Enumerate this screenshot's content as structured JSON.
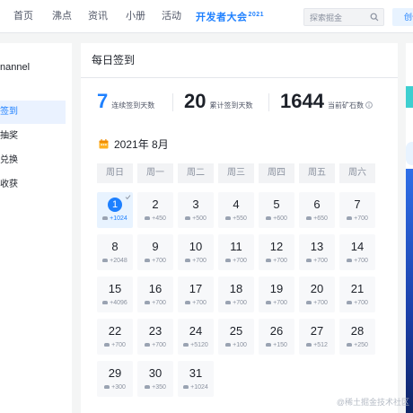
{
  "nav": {
    "items": [
      "首页",
      "沸点",
      "资讯",
      "小册",
      "活动"
    ],
    "brand": "开发者大会",
    "brand_year": "2021",
    "search_placeholder": "探索掘金",
    "create_label": "创作者中心"
  },
  "sidebar": {
    "title": "nannel",
    "items": [
      {
        "label": "签到",
        "active": true
      },
      {
        "label": "抽奖",
        "active": false
      },
      {
        "label": "兑换",
        "active": false
      },
      {
        "label": "收获",
        "active": false
      }
    ]
  },
  "main": {
    "title": "每日签到",
    "stats": [
      {
        "value": "7",
        "label": "连续签到天数"
      },
      {
        "value": "20",
        "label": "累计签到天数"
      },
      {
        "value": "1644",
        "label": "当前矿石数"
      }
    ],
    "month": "2021年 8月",
    "weekdays": [
      "周日",
      "周一",
      "周二",
      "周三",
      "周四",
      "周五",
      "周六"
    ],
    "days": [
      {
        "num": "1",
        "pts": "+1024",
        "today": true
      },
      {
        "num": "2",
        "pts": "+450"
      },
      {
        "num": "3",
        "pts": "+500"
      },
      {
        "num": "4",
        "pts": "+550"
      },
      {
        "num": "5",
        "pts": "+600"
      },
      {
        "num": "6",
        "pts": "+650"
      },
      {
        "num": "7",
        "pts": "+700"
      },
      {
        "num": "8",
        "pts": "+2048"
      },
      {
        "num": "9",
        "pts": "+700"
      },
      {
        "num": "10",
        "pts": "+700"
      },
      {
        "num": "11",
        "pts": "+700"
      },
      {
        "num": "12",
        "pts": "+700"
      },
      {
        "num": "13",
        "pts": "+700"
      },
      {
        "num": "14",
        "pts": "+700"
      },
      {
        "num": "15",
        "pts": "+4096"
      },
      {
        "num": "16",
        "pts": "+700"
      },
      {
        "num": "17",
        "pts": "+700"
      },
      {
        "num": "18",
        "pts": "+700"
      },
      {
        "num": "19",
        "pts": "+700"
      },
      {
        "num": "20",
        "pts": "+700"
      },
      {
        "num": "21",
        "pts": "+700"
      },
      {
        "num": "22",
        "pts": "+700"
      },
      {
        "num": "23",
        "pts": "+700"
      },
      {
        "num": "24",
        "pts": "+5120"
      },
      {
        "num": "25",
        "pts": "+100"
      },
      {
        "num": "26",
        "pts": "+150"
      },
      {
        "num": "27",
        "pts": "+512"
      },
      {
        "num": "28",
        "pts": "+250"
      },
      {
        "num": "29",
        "pts": "+300"
      },
      {
        "num": "30",
        "pts": "+350"
      },
      {
        "num": "31",
        "pts": "+1024"
      }
    ]
  },
  "watermark": "@稀土掘金技术社区",
  "colors": {
    "accent": "#1e80ff",
    "today_bg": "#e8f3ff",
    "day_bg": "#f7f8fa",
    "weekday_bg": "#f2f3f5"
  },
  "icons": {
    "search": "search-icon",
    "calendar": "calendar-icon",
    "info": "info-icon",
    "ore": "ore-icon",
    "check": "check-icon"
  }
}
